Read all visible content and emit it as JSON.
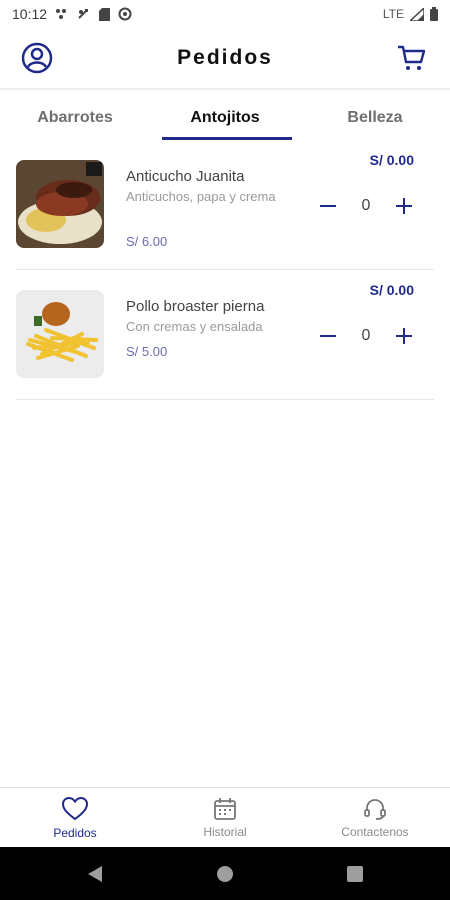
{
  "status_bar": {
    "time": "10:12",
    "network": "LTE"
  },
  "app": {
    "title": "Pedidos"
  },
  "tabs": [
    {
      "label": "Abarrotes"
    },
    {
      "label": "Antojitos",
      "active": true
    },
    {
      "label": "Belleza"
    }
  ],
  "products": [
    {
      "name": "Anticucho Juanita",
      "description": "Anticuchos, papa y crema",
      "price": "S/ 6.00",
      "subtotal": "S/ 0.00",
      "quantity": "0"
    },
    {
      "name": "Pollo broaster pierna",
      "description": "Con cremas y ensalada",
      "price": "S/ 5.00",
      "subtotal": "S/ 0.00",
      "quantity": "0"
    }
  ],
  "bottom_nav": [
    {
      "label": "Pedidos",
      "icon": "heart-icon",
      "active": true
    },
    {
      "label": "Historial",
      "icon": "calendar-icon"
    },
    {
      "label": "Contactenos",
      "icon": "headset-icon"
    }
  ],
  "colors": {
    "accent": "#1f2a8a",
    "price": "#6a6ab0",
    "muted": "#9a9a9a"
  }
}
